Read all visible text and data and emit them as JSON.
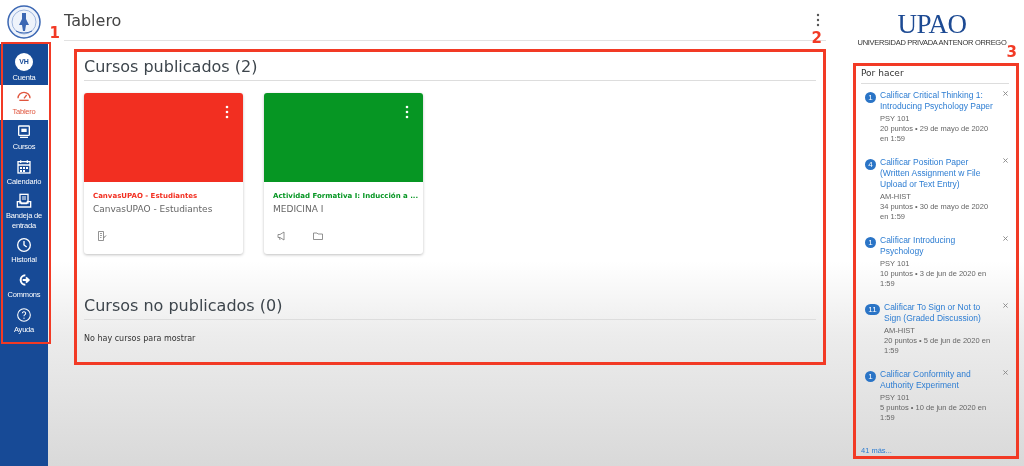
{
  "sidebar": {
    "items": [
      {
        "label": "Cuenta",
        "kind": "avatar",
        "initials": "VH",
        "selected": false
      },
      {
        "label": "Tablero",
        "kind": "dashboard",
        "selected": true
      },
      {
        "label": "Cursos",
        "kind": "courses",
        "selected": false
      },
      {
        "label": "Calendario",
        "kind": "calendar",
        "selected": false
      },
      {
        "label": "Bandeja de entrada",
        "kind": "inbox",
        "selected": false
      },
      {
        "label": "Historial",
        "kind": "history",
        "selected": false
      },
      {
        "label": "Commons",
        "kind": "commons",
        "selected": false
      },
      {
        "label": "Ayuda",
        "kind": "help",
        "selected": false
      }
    ]
  },
  "header": {
    "title": "Tablero"
  },
  "published": {
    "heading": "Cursos publicados (2)",
    "cards": [
      {
        "title": "CanvasUPAO - Estudiantes",
        "subtitle": "CanvasUPAO - Estudiantes",
        "color": "#f22f21",
        "actions": [
          {
            "kind": "assignment"
          }
        ]
      },
      {
        "title": "Actividad Formativa I: Inducción a ...",
        "subtitle": "MEDICINA I",
        "color": "#069623",
        "actions": [
          {
            "kind": "announcement"
          },
          {
            "kind": "folder"
          }
        ]
      }
    ]
  },
  "unpublished": {
    "heading": "Cursos no publicados (0)",
    "empty": "No hay cursos para mostrar"
  },
  "logo": {
    "name": "UPAO",
    "tagline": "UNIVERSIDAD PRIVADA ANTENOR ORREGO"
  },
  "todo": {
    "title": "Por hacer",
    "items": [
      {
        "count": "1",
        "title": "Calificar Critical Thinking 1: Introducing Psychology Paper",
        "course": "PSY 101",
        "details": "20 puntos • 29 de mayo de 2020 en 1:59"
      },
      {
        "count": "4",
        "title": "Calificar Position Paper (Written Assignment w File Upload or Text Entry)",
        "course": "AM-HIST",
        "details": "34 puntos • 30 de mayo de 2020 en 1:59"
      },
      {
        "count": "1",
        "title": "Calificar Introducing Psychology",
        "course": "PSY 101",
        "details": "10 puntos • 3 de jun de 2020 en 1:59"
      },
      {
        "count": "11",
        "title": "Calificar To Sign or Not to Sign (Graded Discussion)",
        "course": "AM-HIST",
        "details": "20 puntos • 5 de jun de 2020 en 1:59"
      },
      {
        "count": "1",
        "title": "Calificar Conformity and Authority Experiment",
        "course": "PSY 101",
        "details": "5 puntos • 10 de jun de 2020 en 1:59"
      }
    ],
    "more": "41 más..."
  },
  "annotations": [
    {
      "label": "1",
      "kind": "sidebar"
    },
    {
      "label": "2",
      "kind": "courses"
    },
    {
      "label": "3",
      "kind": "todo"
    }
  ]
}
